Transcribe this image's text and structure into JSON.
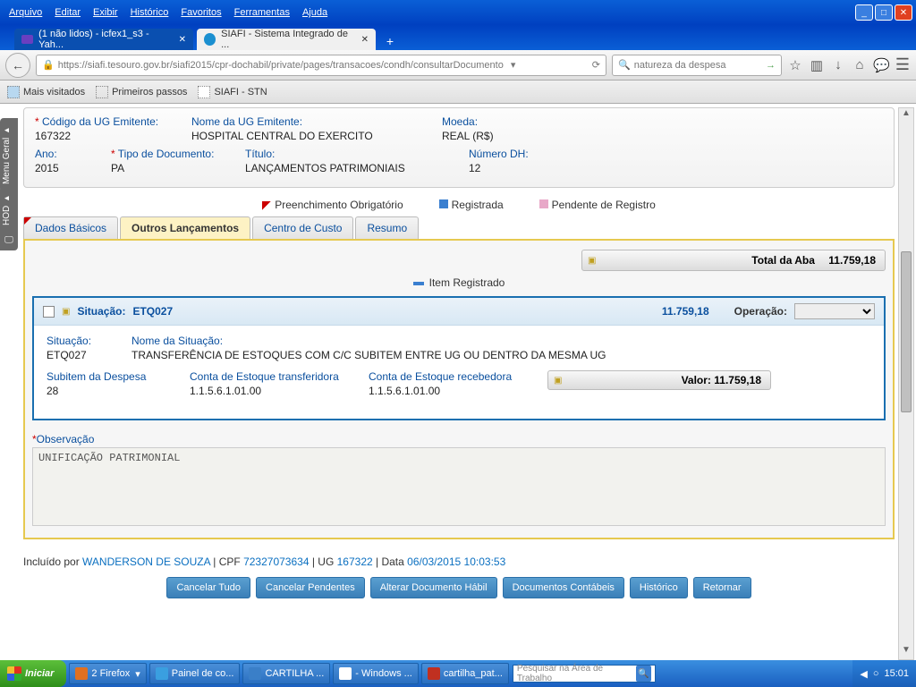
{
  "menu": {
    "arquivo": "Arquivo",
    "editar": "Editar",
    "exibir": "Exibir",
    "historico": "Histórico",
    "favoritos": "Favoritos",
    "ferramentas": "Ferramentas",
    "ajuda": "Ajuda"
  },
  "tabs": {
    "t1": "(1 não lidos) - icfex1_s3 - Yah...",
    "t2": "SIAFI - Sistema Integrado de ..."
  },
  "url": "https://siafi.tesouro.gov.br/siafi2015/cpr-dochabil/private/pages/transacoes/condh/consultarDocumento",
  "search_placeholder": "natureza da despesa",
  "bookmarks": {
    "b1": "Mais visitados",
    "b2": "Primeiros passos",
    "b3": "SIAFI - STN"
  },
  "side": {
    "s1": "Menu Geral",
    "s2": "HOD"
  },
  "header": {
    "codigo_lbl": "Código da UG Emitente:",
    "codigo_val": "167322",
    "nomeug_lbl": "Nome da UG Emitente:",
    "nomeug_val": "HOSPITAL CENTRAL DO EXERCITO",
    "moeda_lbl": "Moeda:",
    "moeda_val": "REAL (R$)",
    "ano_lbl": "Ano:",
    "ano_val": "2015",
    "tipo_lbl": "Tipo de Documento:",
    "tipo_val": "PA",
    "titulo_lbl": "Título:",
    "titulo_val": "LANÇAMENTOS PATRIMONIAIS",
    "numdh_lbl": "Número DH:",
    "numdh_val": "12"
  },
  "legend": {
    "l1": "Preenchimento Obrigatório",
    "l2": "Registrada",
    "l3": "Pendente de Registro"
  },
  "ptabs": {
    "t1": "Dados Básicos",
    "t2": "Outros Lançamentos",
    "t3": "Centro de Custo",
    "t4": "Resumo"
  },
  "total": {
    "lbl": "Total da Aba",
    "val": "11.759,18"
  },
  "itemreg": "Item Registrado",
  "situ": {
    "lbl": "Situação:",
    "code": "ETQ027",
    "amount": "11.759,18",
    "op_lbl": "Operação:",
    "sit_lbl": "Situação:",
    "sit_val": "ETQ027",
    "nome_lbl": "Nome da Situação:",
    "nome_val": "TRANSFERÊNCIA DE ESTOQUES COM C/C SUBITEM ENTRE UG OU DENTRO DA MESMA UG",
    "sub_lbl": "Subitem da Despesa",
    "sub_val": "28",
    "ct_lbl": "Conta de Estoque transferidora",
    "ct_val": "1.1.5.6.1.01.00",
    "cr_lbl": "Conta de Estoque recebedora",
    "cr_val": "1.1.5.6.1.01.00",
    "valor_lbl": "Valor:",
    "valor_val": "11.759,18"
  },
  "obs": {
    "lbl": "Observação",
    "val": "UNIFICAÇÃO PATRIMONIAL"
  },
  "incl": {
    "pre": "Incluído por ",
    "user": "WANDERSON DE SOUZA",
    "cpf_l": " | CPF ",
    "cpf": "72327073634",
    "ug_l": " | UG ",
    "ug": "167322",
    "data_l": " | Data ",
    "data": "06/03/2015 10:03:53"
  },
  "buttons": {
    "b1": "Cancelar Tudo",
    "b2": "Cancelar Pendentes",
    "b3": "Alterar Documento Hábil",
    "b4": "Documentos Contábeis",
    "b5": "Histórico",
    "b6": "Retornar"
  },
  "taskbar": {
    "start": "Iniciar",
    "t1": "2 Firefox",
    "t2": "Painel de co...",
    "t3": "CARTILHA ...",
    "t4": " - Windows ...",
    "t5": "cartilha_pat...",
    "search": "Pesquisar na Área de Trabalho",
    "clock": "15:01"
  }
}
